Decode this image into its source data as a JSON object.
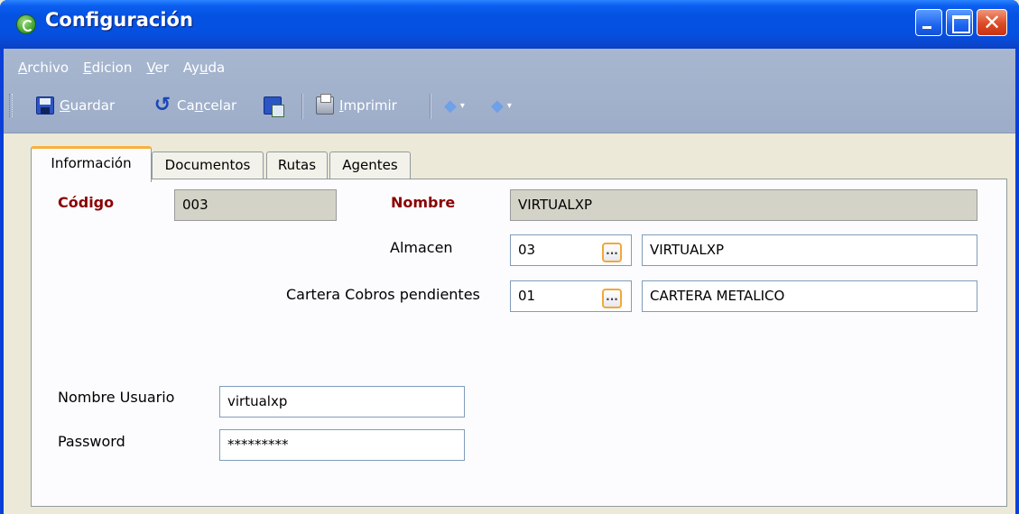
{
  "window": {
    "title": "Configuración",
    "close_glyph": "✕"
  },
  "menu": [
    {
      "mnemonic": "A",
      "rest": "rchivo"
    },
    {
      "mnemonic": "E",
      "rest": "dicion"
    },
    {
      "mnemonic": "V",
      "rest": "er"
    },
    {
      "pre": "Ay",
      "mnemonic": "u",
      "rest": "da"
    }
  ],
  "toolbar": {
    "save": {
      "mnemonic": "G",
      "rest": "uardar"
    },
    "cancel": {
      "pre": "Ca",
      "mnemonic": "n",
      "rest": "celar"
    },
    "print": {
      "mnemonic": "I",
      "rest": "mprimir"
    },
    "undo_glyph": "↺",
    "prev_glyph": "◆",
    "next_glyph": "◆",
    "dropdown_glyph": "▾"
  },
  "tabs": [
    "Información",
    "Documentos",
    "Rutas",
    "Agentes"
  ],
  "form": {
    "codigo_label": "Código",
    "codigo_value": "003",
    "nombre_label": "Nombre",
    "nombre_value": "VIRTUALXP",
    "almacen_label": "Almacen",
    "almacen_code": "03",
    "almacen_name": "VIRTUALXP",
    "cartera_label": "Cartera Cobros pendientes",
    "cartera_code": "01",
    "cartera_name": "CARTERA METALICO",
    "lookup_glyph": "...",
    "usuario_label": "Nombre Usuario",
    "usuario_value": "virtualxp",
    "password_label": "Password",
    "password_value": "*********"
  },
  "colors": {
    "titlebar": "#0553e3",
    "toolbar": "#a2b2cc",
    "label_red": "#8b0000",
    "tab_accent": "#f7b13b"
  }
}
